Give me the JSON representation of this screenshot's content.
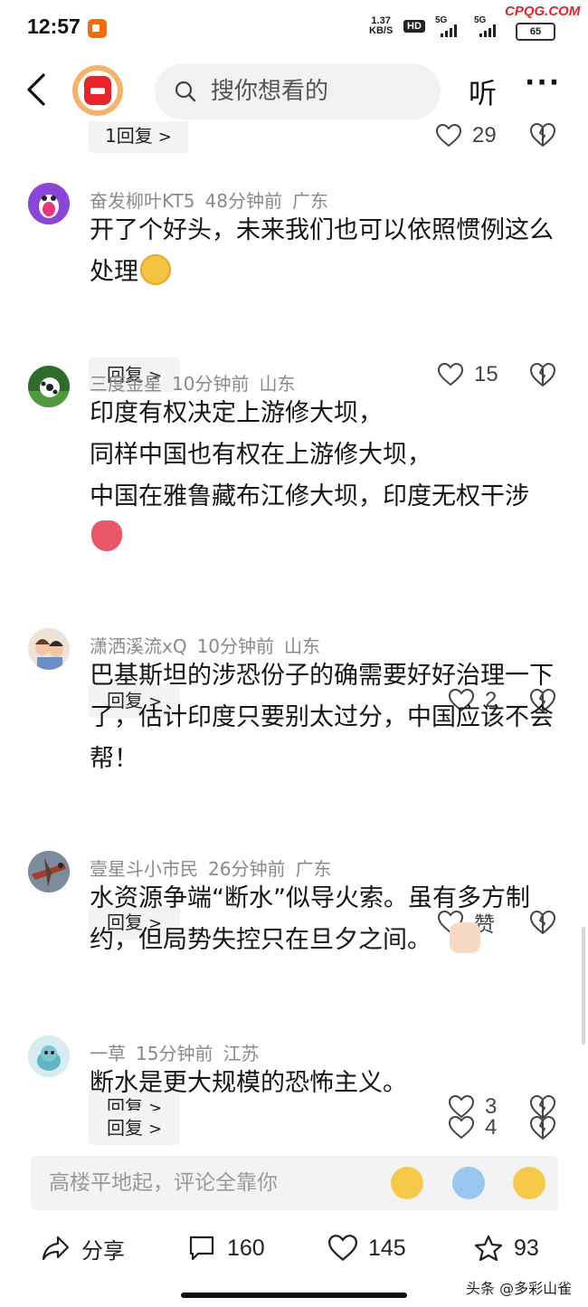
{
  "status_bar": {
    "time": "12:57",
    "speed_value": "1.37",
    "speed_unit": "KB/S",
    "hd_badge": "HD",
    "net1": "5G",
    "net2": "5G",
    "battery": "65",
    "site_watermark": "CPQG.COM"
  },
  "header": {
    "search_placeholder": "搜你想看的",
    "listen_label": "听",
    "more_label": "···"
  },
  "comments": {
    "prev_reply_label": "1回复",
    "prev_likes": "29",
    "reply_label": "回复",
    "items": [
      {
        "user": "奋发柳叶KT5",
        "time": "48分钟前",
        "region": "广东",
        "text": "开了个好头，未来我们也可以依照惯例这么处理",
        "emoji": "grinning-emoji",
        "likes": "15"
      },
      {
        "user": "三度金星",
        "time": "10分钟前",
        "region": "山东",
        "line1": "印度有权决定上游修大坝，",
        "line2": "同样中国也有权在上游修大坝，",
        "line3": "中国在雅鲁藏布江修大坝，印度无权干涉",
        "emoji": "tulip-emoji",
        "likes": "2"
      },
      {
        "user": "潇洒溪流xQ",
        "time": "10分钟前",
        "region": "山东",
        "text": "巴基斯坦的涉恐份子的确需要好好治理一下了，估计印度只要别太过分，中国应该不会帮！",
        "likes": "赞"
      },
      {
        "user": "壹星斗小市民",
        "time": "26分钟前",
        "region": "广东",
        "text": "水资源争端“断水”似导火索。虽有多方制约，但局势失控只在旦夕之间。",
        "emoji": "finger-heart-emoji",
        "likes": "3"
      },
      {
        "user": "一草",
        "time": "15分钟前",
        "region": "江苏",
        "text": "断水是更大规模的恐怖主义。",
        "likes": "4"
      }
    ]
  },
  "composer": {
    "placeholder": "高楼平地起，评论全靠你"
  },
  "actions": {
    "share_label": "分享",
    "comment_count": "160",
    "like_count": "145",
    "fav_count": "93"
  },
  "watermark": "头条 @多彩山雀",
  "colors": {
    "accent": "#e8242a",
    "meta_text": "#8a8a8a",
    "chip_bg": "#f3f3f5"
  }
}
